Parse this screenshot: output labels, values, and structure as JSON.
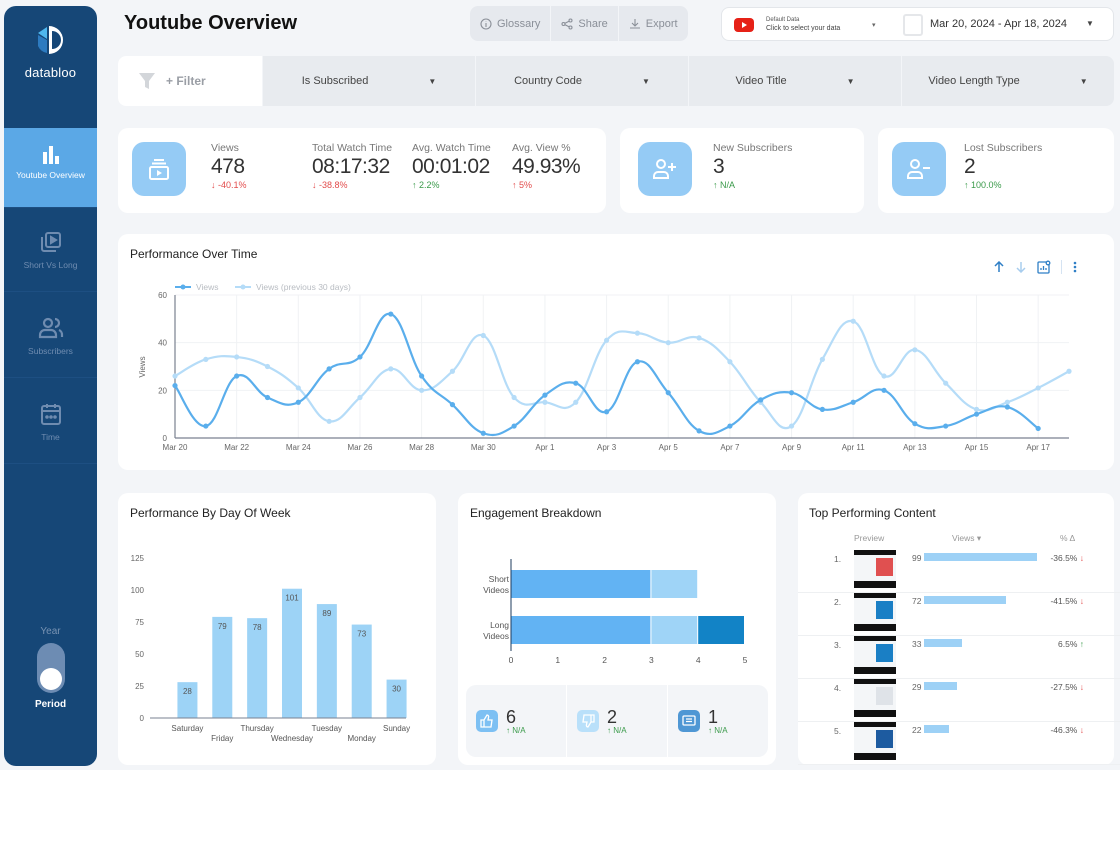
{
  "app": {
    "brand": "databloo",
    "page_title": "Youtube Overview"
  },
  "sidebar": {
    "items": [
      {
        "label": "Youtube Overview",
        "icon": "bar-chart-icon",
        "active": true
      },
      {
        "label": "Short Vs Long",
        "icon": "video-library-icon",
        "active": false
      },
      {
        "label": "Subscribers",
        "icon": "people-icon",
        "active": false
      },
      {
        "label": "Time",
        "icon": "calendar-icon",
        "active": false
      }
    ],
    "period_toggle": {
      "top_label": "Year",
      "bottom_label": "Period",
      "selected": "Period"
    }
  },
  "toolbar": {
    "glossary": "Glossary",
    "share": "Share",
    "export": "Export"
  },
  "datasource": {
    "small": "Default Data",
    "main": "Click to select your data",
    "date_range": "Mar 20, 2024 - Apr 18, 2024"
  },
  "filters": {
    "add_label": "+ Filter",
    "dropdowns": [
      "Is Subscribed",
      "Country Code",
      "Video Title",
      "Video Length Type"
    ]
  },
  "kpis": {
    "views": {
      "label": "Views",
      "value": "478",
      "change": "-40.1%",
      "dir": "down"
    },
    "watch_time": {
      "label": "Total Watch Time",
      "value": "08:17:32",
      "change": "-38.8%",
      "dir": "down"
    },
    "avg_watch": {
      "label": "Avg. Watch Time",
      "value": "00:01:02",
      "change": "2.2%",
      "dir": "up"
    },
    "avg_view_pct": {
      "label": "Avg. View %",
      "value": "49.93%",
      "change": "5%",
      "dir": "up"
    },
    "new_subs": {
      "label": "New Subscribers",
      "value": "3",
      "change": "N/A",
      "dir": "up"
    },
    "lost_subs": {
      "label": "Lost Subscribers",
      "value": "2",
      "change": "100.0%",
      "dir": "up"
    }
  },
  "colors": {
    "primary_line": "#5aaeec",
    "prev_line": "#b5dcf8",
    "bar": "#9dd3f6",
    "sidebar": "#164777",
    "active_nav": "#5ba8e6",
    "down": "#e24b4b",
    "up": "#3a9a4a"
  },
  "chart_data": [
    {
      "type": "line",
      "title": "Performance Over Time",
      "ylabel": "Views",
      "xlabel": "",
      "ylim": [
        0,
        60
      ],
      "yticks": [
        0,
        20,
        40,
        60
      ],
      "x": [
        "Mar 20",
        "Mar 21",
        "Mar 22",
        "Mar 23",
        "Mar 24",
        "Mar 25",
        "Mar 26",
        "Mar 27",
        "Mar 28",
        "Mar 29",
        "Mar 30",
        "Mar 31",
        "Apr 1",
        "Apr 2",
        "Apr 3",
        "Apr 4",
        "Apr 5",
        "Apr 6",
        "Apr 7",
        "Apr 8",
        "Apr 9",
        "Apr 10",
        "Apr 11",
        "Apr 12",
        "Apr 13",
        "Apr 14",
        "Apr 15",
        "Apr 16",
        "Apr 17",
        "Apr 18"
      ],
      "xtick_labels": [
        "Mar 20",
        "Mar 22",
        "Mar 24",
        "Mar 26",
        "Mar 28",
        "Mar 30",
        "Apr 1",
        "Apr 3",
        "Apr 5",
        "Apr 7",
        "Apr 9",
        "Apr 11",
        "Apr 13",
        "Apr 15",
        "Apr 17"
      ],
      "legend": "top-left",
      "grid": true,
      "series": [
        {
          "name": "Views",
          "values": [
            22,
            5,
            26,
            17,
            15,
            29,
            34,
            52,
            26,
            14,
            2,
            5,
            18,
            23,
            11,
            32,
            19,
            3,
            5,
            16,
            19,
            12,
            15,
            20,
            6,
            5,
            10,
            13,
            4,
            null
          ]
        },
        {
          "name": "Views (previous 30 days)",
          "values": [
            26,
            33,
            34,
            30,
            21,
            7,
            17,
            29,
            20,
            28,
            43,
            17,
            15,
            15,
            41,
            44,
            40,
            42,
            32,
            15,
            5,
            33,
            49,
            26,
            37,
            23,
            12,
            15,
            21,
            28
          ]
        }
      ]
    },
    {
      "type": "bar",
      "title": "Performance By Day Of Week",
      "categories": [
        "Saturday",
        "Friday",
        "Thursday",
        "Wednesday",
        "Tuesday",
        "Monday",
        "Sunday"
      ],
      "values": [
        28,
        79,
        78,
        101,
        89,
        73,
        30
      ],
      "ylim": [
        0,
        125
      ],
      "yticks": [
        0,
        25,
        50,
        75,
        100,
        125
      ],
      "xlabel": "",
      "ylabel": ""
    },
    {
      "type": "bar",
      "orientation": "horizontal-stacked",
      "title": "Engagement Breakdown",
      "categories": [
        "Short Videos",
        "Long Videos"
      ],
      "series": [
        {
          "name": "Likes",
          "values": [
            3,
            3
          ]
        },
        {
          "name": "Dislikes",
          "values": [
            1,
            1
          ]
        },
        {
          "name": "Comments",
          "values": [
            0,
            1
          ]
        }
      ],
      "xlim": [
        0,
        5
      ],
      "xticks": [
        0,
        1,
        2,
        3,
        4,
        5
      ]
    }
  ],
  "engagement_totals": [
    {
      "name": "likes",
      "value": "6",
      "change": "N/A"
    },
    {
      "name": "dislikes",
      "value": "2",
      "change": "N/A"
    },
    {
      "name": "comments",
      "value": "1",
      "change": "N/A"
    }
  ],
  "top_content": {
    "title": "Top Performing Content",
    "headers": {
      "preview": "Preview",
      "views": "Views ▾",
      "delta": "% Δ"
    },
    "max": 99,
    "rows": [
      {
        "rank": "1.",
        "views": 99,
        "delta": "-36.5%",
        "dir": "down"
      },
      {
        "rank": "2.",
        "views": 72,
        "delta": "-41.5%",
        "dir": "down"
      },
      {
        "rank": "3.",
        "views": 33,
        "delta": "6.5%",
        "dir": "up"
      },
      {
        "rank": "4.",
        "views": 29,
        "delta": "-27.5%",
        "dir": "down"
      },
      {
        "rank": "5.",
        "views": 22,
        "delta": "-46.3%",
        "dir": "down"
      }
    ]
  }
}
